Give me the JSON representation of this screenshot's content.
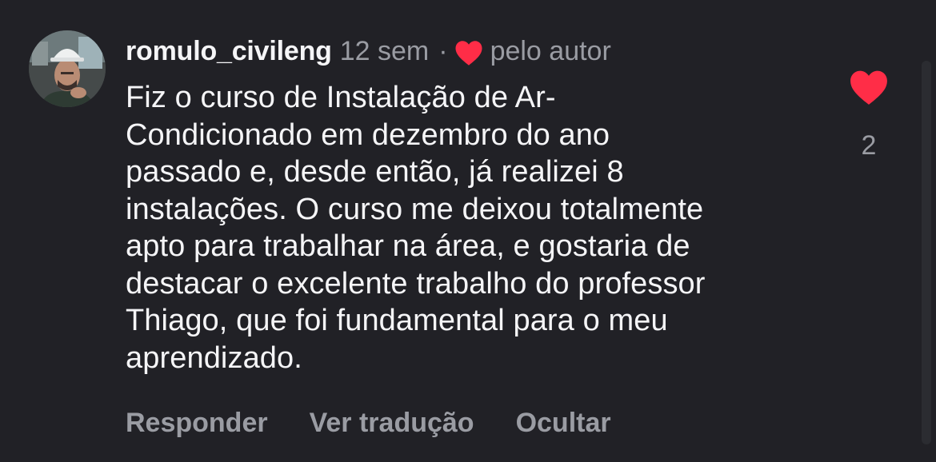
{
  "comment": {
    "username": "romulo_civileng",
    "timestamp": "12 sem",
    "separator": "·",
    "liked_by_author_label": "pelo autor",
    "liked_by_author_icon": "heart-icon",
    "text": "Fiz o curso de Instalação de Ar-\nCondicionado em dezembro do ano\npassado e, desde então, já realizei 8\ninstalações. O curso me deixou totalmente\napto para trabalhar na área, e gostaria de\ndestacar o excelente trabalho do professor\nThiago, que foi fundamental para o meu\naprendizado.",
    "like_count": "2",
    "liked": true
  },
  "actions": {
    "reply_label": "Responder",
    "translate_label": "Ver tradução",
    "hide_label": "Ocultar"
  },
  "colors": {
    "background": "#212126",
    "primary_text": "#f5f5f7",
    "secondary_text": "#9a9ca3",
    "heart": "#ff2d47"
  }
}
